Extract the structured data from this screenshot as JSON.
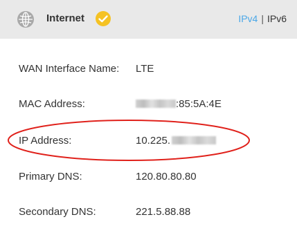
{
  "header": {
    "title": "Internet",
    "status_icon": "check-circle-icon",
    "status_color": "#f5c223",
    "ipv4_label": "IPv4",
    "separator": "|",
    "ipv6_label": "IPv6",
    "active_color": "#4aa7e8"
  },
  "details": {
    "wan_label": "WAN Interface Name:",
    "wan_value": "LTE",
    "mac_label": "MAC Address:",
    "mac_value_visible": ":85:5A:4E",
    "ip_label": "IP Address:",
    "ip_value_visible": "10.225.",
    "primary_dns_label": "Primary DNS:",
    "primary_dns_value": "120.80.80.80",
    "secondary_dns_label": "Secondary DNS:",
    "secondary_dns_value": "221.5.88.88"
  },
  "annotation": {
    "color": "#e0201a"
  }
}
